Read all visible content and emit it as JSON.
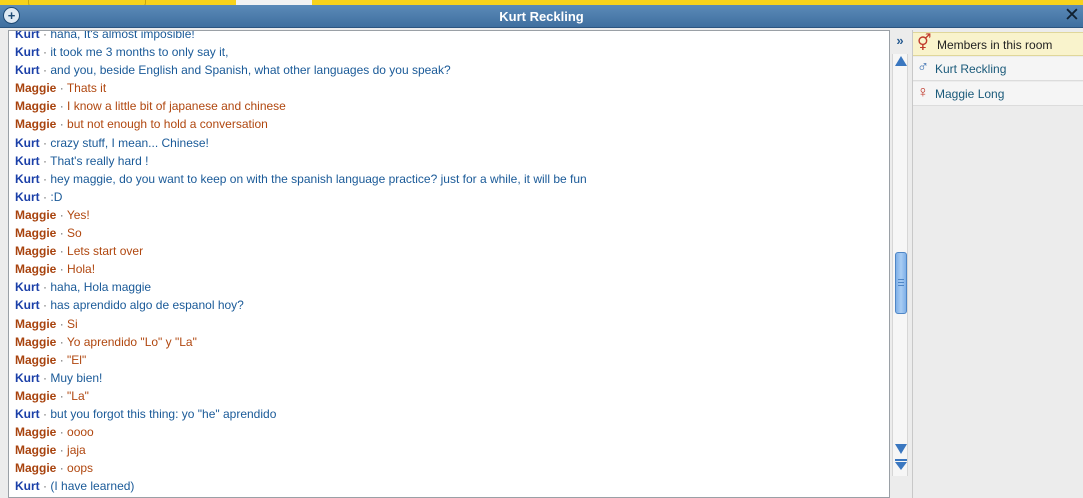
{
  "window": {
    "title": "Kurt Reckling"
  },
  "members_panel": {
    "header": "Members in this room",
    "members": [
      {
        "name": "Kurt Reckling",
        "gender_icon": "male-icon"
      },
      {
        "name": "Maggie Long",
        "gender_icon": "female-icon"
      }
    ]
  },
  "colors": {
    "title_bar": "#4a7aab",
    "kurt_sender": "#1a3fa8",
    "maggie_sender": "#a8430e",
    "members_header_bg": "#f9f3cc"
  },
  "separator": "·",
  "messages": [
    {
      "sender": "Kurt",
      "text": "haha, It's almost imposible!"
    },
    {
      "sender": "Kurt",
      "text": "it took me 3 months to only say it,"
    },
    {
      "sender": "Kurt",
      "text": "and you, beside English and Spanish, what other languages do you speak?"
    },
    {
      "sender": "Maggie",
      "text": "Thats it"
    },
    {
      "sender": "Maggie",
      "text": "I know a little bit of japanese and chinese"
    },
    {
      "sender": "Maggie",
      "text": "but not enough to hold a conversation"
    },
    {
      "sender": "Kurt",
      "text": "crazy stuff, I mean... Chinese!"
    },
    {
      "sender": "Kurt",
      "text": "That's really hard !"
    },
    {
      "sender": "Kurt",
      "text": "hey maggie, do you want to keep on with the spanish language practice? just for a while, it will be fun"
    },
    {
      "sender": "Kurt",
      "text": ":D"
    },
    {
      "sender": "Maggie",
      "text": "Yes!"
    },
    {
      "sender": "Maggie",
      "text": "So"
    },
    {
      "sender": "Maggie",
      "text": "Lets start over"
    },
    {
      "sender": "Maggie",
      "text": "Hola!"
    },
    {
      "sender": "Kurt",
      "text": "haha, Hola maggie"
    },
    {
      "sender": "Kurt",
      "text": "has aprendido algo de espanol hoy?"
    },
    {
      "sender": "Maggie",
      "text": "Si"
    },
    {
      "sender": "Maggie",
      "text": "Yo aprendido \"Lo\" y \"La\""
    },
    {
      "sender": "Maggie",
      "text": "\"El\""
    },
    {
      "sender": "Kurt",
      "text": "Muy bien!"
    },
    {
      "sender": "Maggie",
      "text": "\"La\""
    },
    {
      "sender": "Kurt",
      "text": "but you forgot this thing: yo \"he\" aprendido"
    },
    {
      "sender": "Maggie",
      "text": "oooo"
    },
    {
      "sender": "Maggie",
      "text": "jaja"
    },
    {
      "sender": "Maggie",
      "text": "oops"
    },
    {
      "sender": "Kurt",
      "text": "(I have learned)"
    }
  ]
}
